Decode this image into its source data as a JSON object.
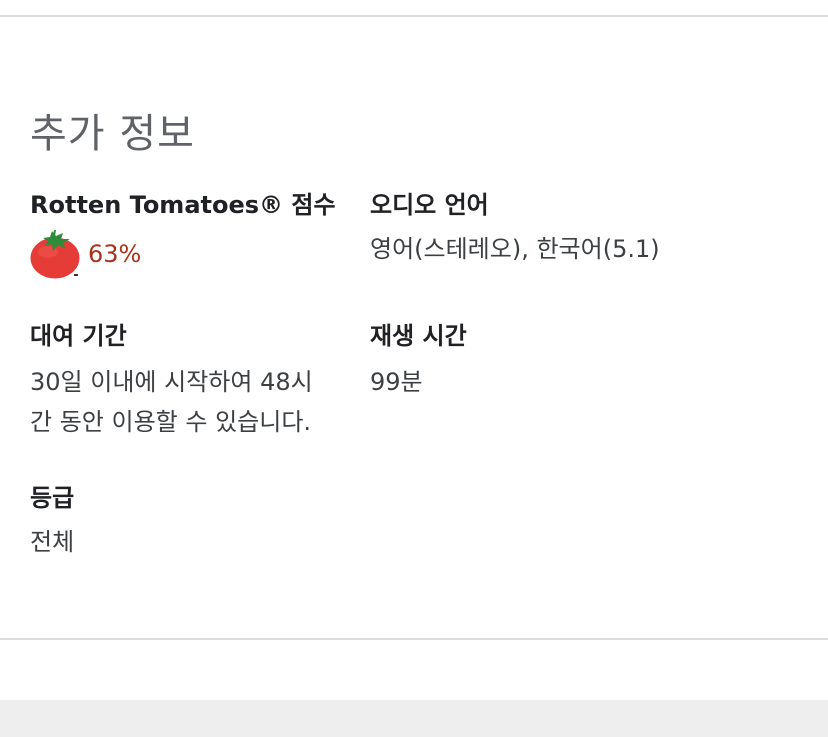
{
  "section": {
    "title": "추가 정보"
  },
  "rotten_tomatoes": {
    "label": "Rotten Tomatoes® 점수",
    "score": "63%",
    "icon": "tomato-icon",
    "score_color": "#a8331c"
  },
  "audio_language": {
    "label": "오디오 언어",
    "value": "영어(스테레오), 한국어(5.1)"
  },
  "rental_period": {
    "label": "대여 기간",
    "value_line1": "30일 이내에 시작하여 48시",
    "value_line2": "간 동안 이용할 수 있습니다."
  },
  "runtime": {
    "label": "재생 시간",
    "value": "99분"
  },
  "rating": {
    "label": "등급",
    "value": "전체"
  }
}
